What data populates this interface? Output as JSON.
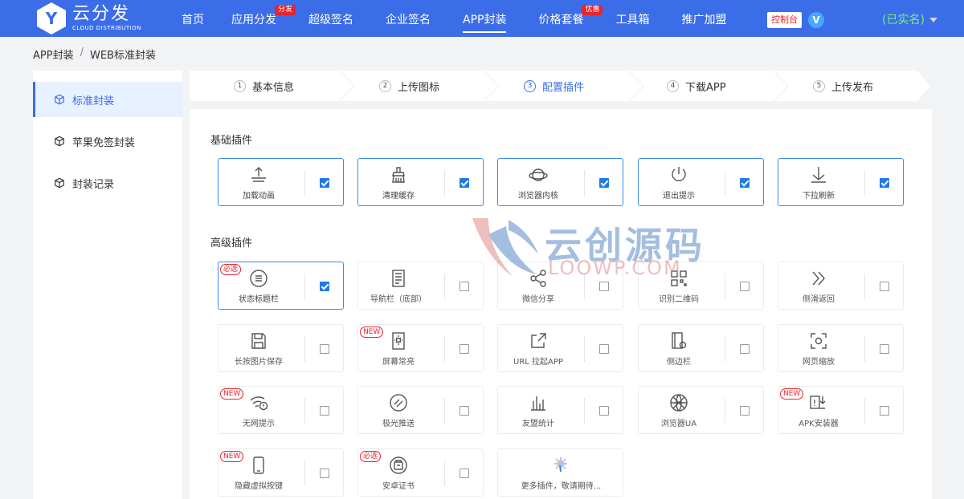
{
  "brand": {
    "mark": "Y",
    "name_cn": "云分发",
    "name_en": "CLOUD DISTRIBUTION"
  },
  "nav": [
    {
      "label": "首页",
      "badge": ""
    },
    {
      "label": "应用分发",
      "badge": "分发"
    },
    {
      "label": "超级签名",
      "badge": ""
    },
    {
      "label": "企业签名",
      "badge": ""
    },
    {
      "label": "APP封装",
      "badge": ""
    },
    {
      "label": "价格套餐",
      "badge": "优惠"
    },
    {
      "label": "工具箱",
      "badge": ""
    },
    {
      "label": "推广加盟",
      "badge": ""
    }
  ],
  "nav_active_index": 4,
  "header": {
    "console_label": "控制台",
    "vip_badge": "V",
    "user_status": "(已实名)"
  },
  "breadcrumb": {
    "parent": "APP封装",
    "separator": "/",
    "current": "WEB标准封装"
  },
  "sidebar": {
    "items": [
      {
        "label": "标准封装"
      },
      {
        "label": "苹果免签封装"
      },
      {
        "label": "封装记录"
      }
    ],
    "active_index": 0
  },
  "steps": [
    {
      "num": "1",
      "label": "基本信息"
    },
    {
      "num": "2",
      "label": "上传图标"
    },
    {
      "num": "3",
      "label": "配置插件"
    },
    {
      "num": "4",
      "label": "下载APP"
    },
    {
      "num": "5",
      "label": "上传发布"
    }
  ],
  "steps_active_index": 2,
  "sections": {
    "basic_title": "基础插件",
    "advanced_title": "高级插件"
  },
  "basic_plugins": [
    {
      "label": "加载动画",
      "icon": "upload-tray-icon",
      "checked": true,
      "tag": ""
    },
    {
      "label": "清理缓存",
      "icon": "broom-icon",
      "checked": true,
      "tag": ""
    },
    {
      "label": "浏览器内核",
      "icon": "planet-icon",
      "checked": true,
      "tag": ""
    },
    {
      "label": "退出提示",
      "icon": "power-icon",
      "checked": true,
      "tag": ""
    },
    {
      "label": "下拉刷新",
      "icon": "pull-down-icon",
      "checked": true,
      "tag": ""
    }
  ],
  "advanced_plugins": [
    {
      "label": "状态标题栏",
      "icon": "menu-circle-icon",
      "checked": true,
      "tag": "必选"
    },
    {
      "label": "导航栏（底部）",
      "icon": "document-icon",
      "checked": false,
      "tag": ""
    },
    {
      "label": "微信分享",
      "icon": "share-icon",
      "checked": false,
      "tag": ""
    },
    {
      "label": "识别二维码",
      "icon": "qrcode-icon",
      "checked": false,
      "tag": ""
    },
    {
      "label": "侧滑返回",
      "icon": "double-chevron-icon",
      "checked": false,
      "tag": ""
    },
    {
      "label": "长按图片保存",
      "icon": "save-icon",
      "checked": false,
      "tag": ""
    },
    {
      "label": "屏幕常亮",
      "icon": "screen-brightness-icon",
      "checked": false,
      "tag": "NEW"
    },
    {
      "label": "URL 拉起APP",
      "icon": "external-link-icon",
      "checked": false,
      "tag": ""
    },
    {
      "label": "侧边栏",
      "icon": "sidebar-phone-icon",
      "checked": false,
      "tag": ""
    },
    {
      "label": "网页缩放",
      "icon": "zoom-frame-icon",
      "checked": false,
      "tag": ""
    },
    {
      "label": "无网提示",
      "icon": "wifi-alert-icon",
      "checked": false,
      "tag": "NEW"
    },
    {
      "label": "极光推送",
      "icon": "push-circle-icon",
      "checked": false,
      "tag": ""
    },
    {
      "label": "友盟统计",
      "icon": "bar-stats-icon",
      "checked": false,
      "tag": ""
    },
    {
      "label": "浏览器UA",
      "icon": "globe-icon",
      "checked": false,
      "tag": ""
    },
    {
      "label": "APK安装器",
      "icon": "apk-install-icon",
      "checked": false,
      "tag": "NEW"
    },
    {
      "label": "隐藏虚拟按键",
      "icon": "phone-icon",
      "checked": false,
      "tag": "NEW"
    },
    {
      "label": "安卓证书",
      "icon": "certificate-icon",
      "checked": false,
      "tag": "必选"
    },
    {
      "label": "更多插件，敬请期待...",
      "icon": "gear-more-icon",
      "checked": null,
      "tag": ""
    }
  ],
  "watermark": {
    "cn": "云创源码",
    "en": "LOOWP.COM"
  },
  "colors": {
    "primary": "#3b6de8",
    "badge_red": "#e8242c",
    "checked_blue": "#1f7ae6",
    "realname_green": "#7ef07e"
  }
}
